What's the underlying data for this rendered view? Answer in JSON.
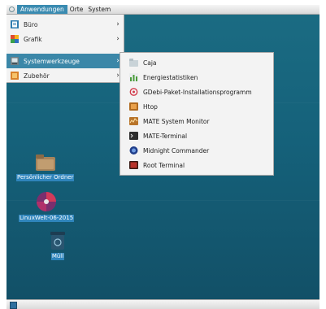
{
  "top_panel": {
    "menus": [
      {
        "label": "Anwendungen"
      },
      {
        "label": "Orte"
      },
      {
        "label": "System"
      }
    ]
  },
  "main_menu": {
    "items": [
      {
        "label": "Büro",
        "icon": "office-icon"
      },
      {
        "label": "Grafik",
        "icon": "graphics-icon"
      },
      {
        "label": "Systemwerkzeuge",
        "icon": "system-tools-icon"
      },
      {
        "label": "Zubehör",
        "icon": "accessories-icon"
      }
    ]
  },
  "sub_menu": {
    "items": [
      {
        "label": "Caja",
        "icon": "caja-icon"
      },
      {
        "label": "Energiestatistiken",
        "icon": "power-statistics-icon"
      },
      {
        "label": "GDebi-Paket-Installationsprogramm",
        "icon": "gdebi-icon"
      },
      {
        "label": "Htop",
        "icon": "htop-icon"
      },
      {
        "label": "MATE System Monitor",
        "icon": "system-monitor-icon"
      },
      {
        "label": "MATE-Terminal",
        "icon": "terminal-icon"
      },
      {
        "label": "Midnight Commander",
        "icon": "midnight-commander-icon"
      },
      {
        "label": "Root Terminal",
        "icon": "root-terminal-icon"
      }
    ]
  },
  "desktop": {
    "icons": [
      {
        "label": "Persönlicher Ordner",
        "icon": "home-folder-icon"
      },
      {
        "label": "LinuxWelt-06-2015",
        "icon": "disc-icon"
      },
      {
        "label": "Müll",
        "icon": "trash-icon"
      }
    ]
  },
  "colors": {
    "accent": "#3b87a8",
    "desktop_bg": "#15617a",
    "label_bg": "#2f85bc"
  }
}
